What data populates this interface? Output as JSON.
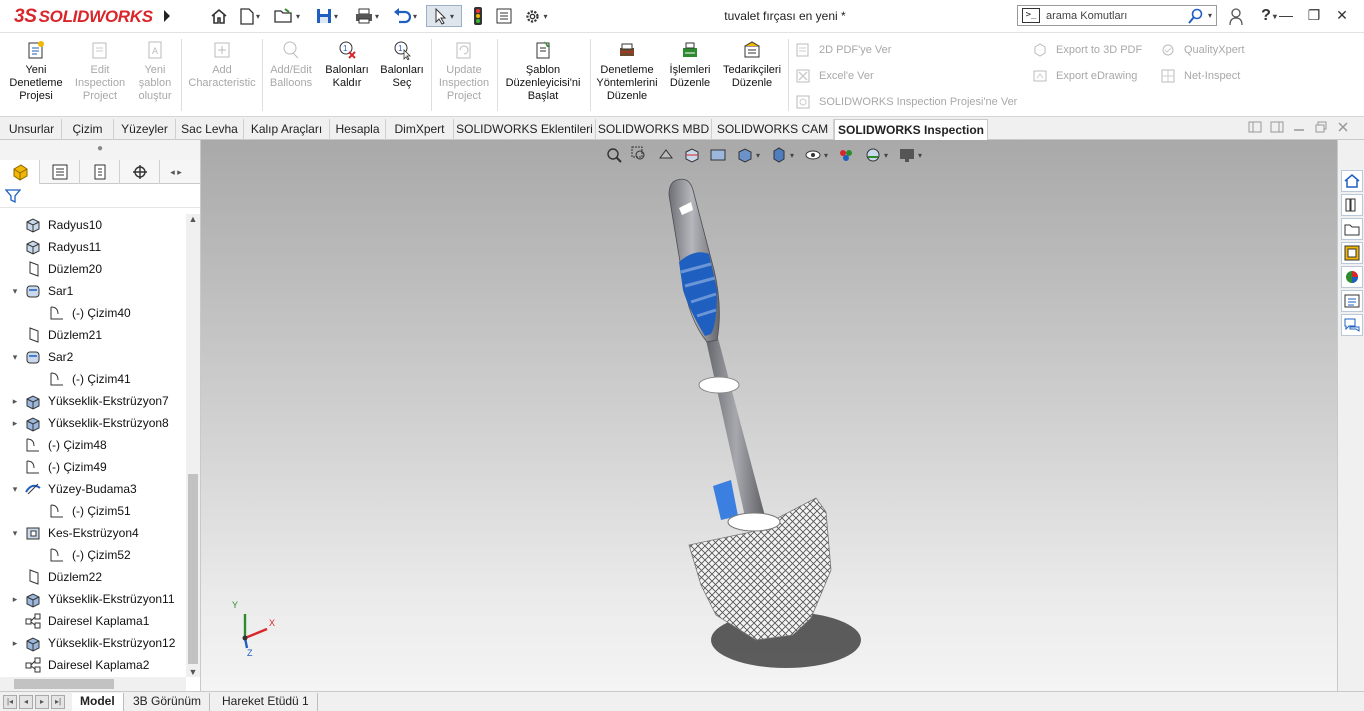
{
  "app": {
    "brand_prefix": "3S",
    "brand": "SOLIDWORKS"
  },
  "document_title": "tuvalet fırçası en yeni *",
  "search": {
    "placeholder": "arama Komutları"
  },
  "ribbon": {
    "commands": [
      {
        "id": "new-project",
        "label": "Yeni Denetleme Projesi",
        "enabled": true,
        "icon": "inspection-new-icon"
      },
      {
        "id": "edit-project",
        "label": "Edit Inspection Project",
        "enabled": false,
        "icon": "inspection-edit-icon"
      },
      {
        "id": "new-template",
        "label": "Yeni şablon oluştur",
        "enabled": false,
        "icon": "template-new-icon"
      },
      {
        "id": "add-characteristic",
        "label": "Add Characteristic",
        "enabled": false,
        "icon": "add-characteristic-icon"
      },
      {
        "id": "add-edit-balloons",
        "label": "Add/Edit Balloons",
        "enabled": false,
        "icon": "balloon-icon"
      },
      {
        "id": "remove-balloons",
        "label": "Balonları Kaldır",
        "enabled": true,
        "icon": "balloon-remove-icon"
      },
      {
        "id": "select-balloons",
        "label": "Balonları Seç",
        "enabled": true,
        "icon": "balloon-select-icon"
      },
      {
        "id": "update-project",
        "label": "Update Inspection Project",
        "enabled": false,
        "icon": "inspection-update-icon"
      },
      {
        "id": "template-editor",
        "label": "Şablon Düzenleyicisi'ni Başlat",
        "enabled": true,
        "icon": "template-editor-icon"
      },
      {
        "id": "edit-methods",
        "label": "Denetleme Yöntemlerini Düzenle",
        "enabled": true,
        "icon": "methods-icon"
      },
      {
        "id": "edit-operations",
        "label": "İşlemleri Düzenle",
        "enabled": true,
        "icon": "operations-icon"
      },
      {
        "id": "edit-vendors",
        "label": "Tedarikçileri Düzenle",
        "enabled": true,
        "icon": "vendors-icon"
      }
    ],
    "exports": [
      {
        "label": "2D PDF'ye Ver",
        "icon": "pdf-2d-icon"
      },
      {
        "label": "Excel'e Ver",
        "icon": "excel-icon"
      },
      {
        "label": "SOLIDWORKS Inspection Projesi'ne Ver",
        "icon": "inspection-export-icon"
      },
      {
        "label": "Export to 3D PDF",
        "icon": "pdf-3d-icon"
      },
      {
        "label": "Export eDrawing",
        "icon": "edrawing-icon"
      },
      {
        "label": "QualityXpert",
        "icon": "qualityxpert-icon"
      },
      {
        "label": "Net-Inspect",
        "icon": "net-inspect-icon"
      }
    ]
  },
  "tabs": [
    "Unsurlar",
    "Çizim",
    "Yüzeyler",
    "Sac Levha",
    "Kalıp Araçları",
    "Hesapla",
    "DimXpert",
    "SOLIDWORKS Eklentileri",
    "SOLIDWORKS MBD",
    "SOLIDWORKS CAM",
    "SOLIDWORKS Inspection"
  ],
  "active_tab": "SOLIDWORKS Inspection",
  "feature_tree": [
    {
      "label": "Radyus10",
      "icon": "fillet-icon",
      "expand": ""
    },
    {
      "label": "Radyus11",
      "icon": "fillet-icon",
      "expand": ""
    },
    {
      "label": "Düzlem20",
      "icon": "plane-icon",
      "expand": ""
    },
    {
      "label": "Sar1",
      "icon": "wrap-icon",
      "expand": "▾"
    },
    {
      "label": "(-) Çizim40",
      "icon": "sketch-icon",
      "expand": "",
      "child": true
    },
    {
      "label": "Düzlem21",
      "icon": "plane-icon",
      "expand": ""
    },
    {
      "label": "Sar2",
      "icon": "wrap-icon",
      "expand": "▾"
    },
    {
      "label": "(-) Çizim41",
      "icon": "sketch-icon",
      "expand": "",
      "child": true
    },
    {
      "label": "Yükseklik-Ekstrüzyon7",
      "icon": "extrude-icon",
      "expand": "▸"
    },
    {
      "label": "Yükseklik-Ekstrüzyon8",
      "icon": "extrude-icon",
      "expand": "▸"
    },
    {
      "label": "(-) Çizim48",
      "icon": "sketch-icon",
      "expand": ""
    },
    {
      "label": "(-) Çizim49",
      "icon": "sketch-icon",
      "expand": ""
    },
    {
      "label": "Yüzey-Budama3",
      "icon": "surface-trim-icon",
      "expand": "▾"
    },
    {
      "label": "(-) Çizim51",
      "icon": "sketch-icon",
      "expand": "",
      "child": true
    },
    {
      "label": "Kes-Ekstrüzyon4",
      "icon": "cut-extrude-icon",
      "expand": "▾"
    },
    {
      "label": "(-) Çizim52",
      "icon": "sketch-icon",
      "expand": "",
      "child": true
    },
    {
      "label": "Düzlem22",
      "icon": "plane-icon",
      "expand": ""
    },
    {
      "label": "Yükseklik-Ekstrüzyon11",
      "icon": "extrude-icon",
      "expand": "▸"
    },
    {
      "label": "Dairesel Kaplama1",
      "icon": "circular-pattern-icon",
      "expand": ""
    },
    {
      "label": "Yükseklik-Ekstrüzyon12",
      "icon": "extrude-icon",
      "expand": "▸"
    },
    {
      "label": "Dairesel Kaplama2",
      "icon": "circular-pattern-icon",
      "expand": ""
    }
  ],
  "bottom_tabs": [
    "Model",
    "3B Görünüm",
    "Hareket Etüdü 1"
  ],
  "active_bottom_tab": "Model",
  "triad": {
    "x": "X",
    "y": "Y",
    "z": "Z"
  },
  "colors": {
    "brand": "#d9262b",
    "accent_blue": "#1f5fbf",
    "handle_gray": "#8f9096"
  }
}
